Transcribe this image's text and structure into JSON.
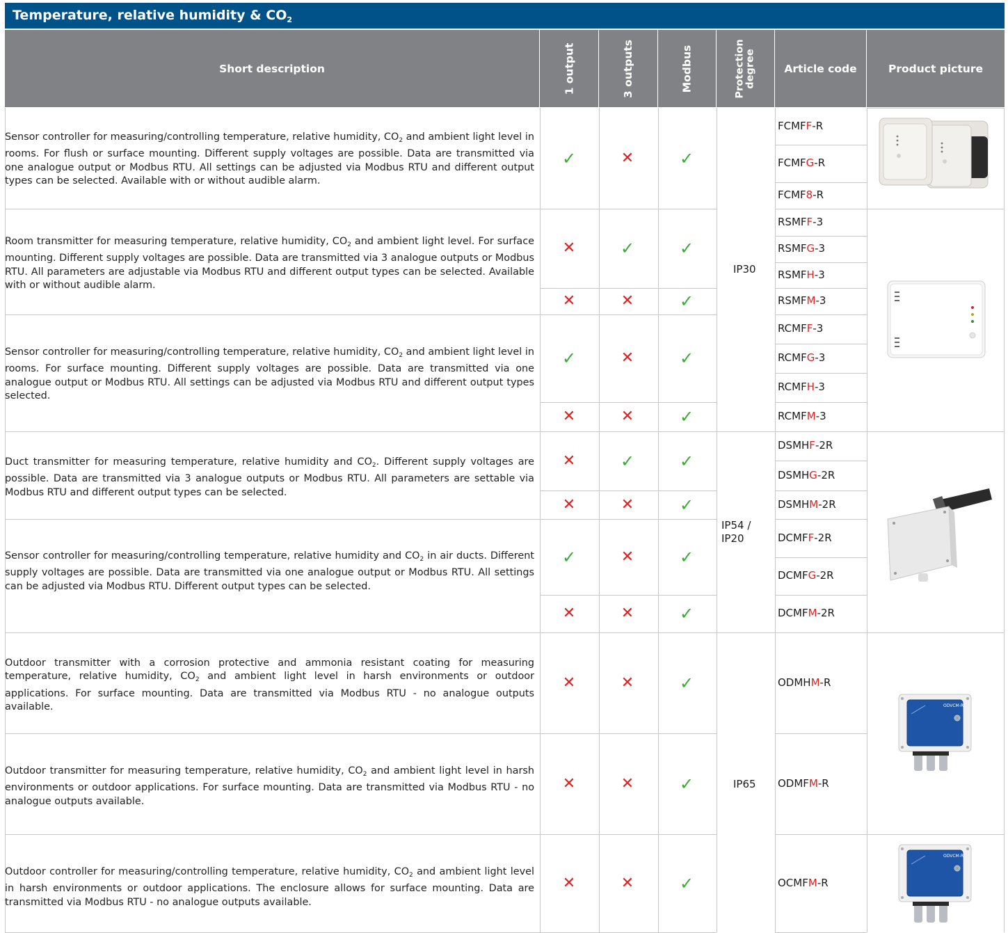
{
  "title": {
    "main": "Temperature, relative humidity & CO",
    "sub": "2"
  },
  "headers": {
    "description": "Short description",
    "one_output": "1 output",
    "three_outputs": "3 outputs",
    "modbus": "Modbus",
    "protection_line1": "Protection",
    "protection_line2": "degree",
    "article_code": "Article code",
    "product_picture": "Product picture"
  },
  "protection": {
    "ip30": "IP30",
    "ip54_line1": "IP54 /",
    "ip54_line2": "IP20",
    "ip65": "IP65"
  },
  "symbols": {
    "yes": "✓",
    "no": "✕"
  },
  "colors": {
    "header_blue": "#02528a",
    "header_grey": "#808285",
    "check_green": "#3aaa35",
    "cross_red": "#e02020",
    "code_highlight": "#e02020"
  },
  "descriptions": [
    {
      "a": "Sensor controller for measuring/controlling temperature, relative humidity, CO",
      "b": " and ambient light level in rooms. For flush or surface mounting. Different supply voltages are possible. Data are transmitted via one analogue output or Modbus RTU. All settings can be adjusted via Modbus RTU and different output types can be selected. Available with or without audible alarm."
    },
    {
      "a": "Room transmitter for measuring temperature, relative humidity, CO",
      "b": " and ambient light level. For surface mounting. Different supply voltages are possible. Data are transmitted via 3 analogue outputs or Modbus RTU. All parameters are adjustable via Modbus RTU and different output types can be selected. Available with or without audible alarm."
    },
    {
      "a": "Sensor controller for measuring/controlling temperature, relative humidity, CO",
      "b": " and ambient light level in rooms. For surface mounting. Different supply voltages are possible. Data are transmitted via one analogue output or Modbus RTU. All settings can be adjusted via Modbus RTU and different output types selected."
    },
    {
      "a": "Duct transmitter for measuring temperature, relative humidity and CO",
      "b": ". Different supply voltages are possible. Data are transmitted via 3 analogue outputs or Modbus RTU. All parameters are settable via Modbus RTU and different output types can be selected."
    },
    {
      "a": "Sensor controller for measuring/controlling temperature, relative humidity and CO",
      "b": " in air ducts. Different supply voltages are possible. Data are transmitted via one analogue output or Modbus RTU. All settings can be adjusted via Modbus RTU. Different output types can be selected."
    },
    {
      "a": "Outdoor transmitter with a corrosion protective and ammonia resistant coating for measuring temperature, relative humidity, CO",
      "b": " and ambient light level in harsh environments or outdoor applications. For surface mounting. Data are transmitted via Modbus RTU - no analogue outputs available."
    },
    {
      "a": "Outdoor transmitter for measuring temperature, relative humidity, CO",
      "b": " and ambient light level in harsh environments or outdoor applications. For surface mounting. Data are transmitted via Modbus RTU - no analogue outputs available."
    },
    {
      "a": "Outdoor controller for measuring/controlling temperature, relative humidity, CO",
      "b": " and ambient light level in harsh environments or outdoor applications. The enclosure allows for surface mounting. Data are transmitted via Modbus RTU - no analogue outputs available."
    }
  ],
  "sub2": "2",
  "codes": [
    {
      "p": "FCMF",
      "h": "F",
      "s": "-R"
    },
    {
      "p": "FCMF",
      "h": "G",
      "s": "-R"
    },
    {
      "p": "FCMF",
      "h": "8",
      "s": "-R"
    },
    {
      "p": "RSMF",
      "h": "F",
      "s": "-3"
    },
    {
      "p": "RSMF",
      "h": "G",
      "s": "-3"
    },
    {
      "p": "RSMF",
      "h": "H",
      "s": "-3"
    },
    {
      "p": "RSMF",
      "h": "M",
      "s": "-3"
    },
    {
      "p": "RCMF",
      "h": "F",
      "s": "-3"
    },
    {
      "p": "RCMF",
      "h": "G",
      "s": "-3"
    },
    {
      "p": "RCMF",
      "h": "H",
      "s": "-3"
    },
    {
      "p": "RCMF",
      "h": "M",
      "s": "-3"
    },
    {
      "p": "DSMH",
      "h": "F",
      "s": "-2R"
    },
    {
      "p": "DSMH",
      "h": "G",
      "s": "-2R"
    },
    {
      "p": "DSMH",
      "h": "M",
      "s": "-2R"
    },
    {
      "p": "DCMF",
      "h": "F",
      "s": "-2R"
    },
    {
      "p": "DCMF",
      "h": "G",
      "s": "-2R"
    },
    {
      "p": "DCMF",
      "h": "M",
      "s": "-2R"
    },
    {
      "p": "ODMH",
      "h": "M",
      "s": "-R"
    },
    {
      "p": "ODMF",
      "h": "M",
      "s": "-R"
    },
    {
      "p": "OCMF",
      "h": "M",
      "s": "-R"
    }
  ],
  "pictures": {
    "label": "ODVCM-R"
  }
}
